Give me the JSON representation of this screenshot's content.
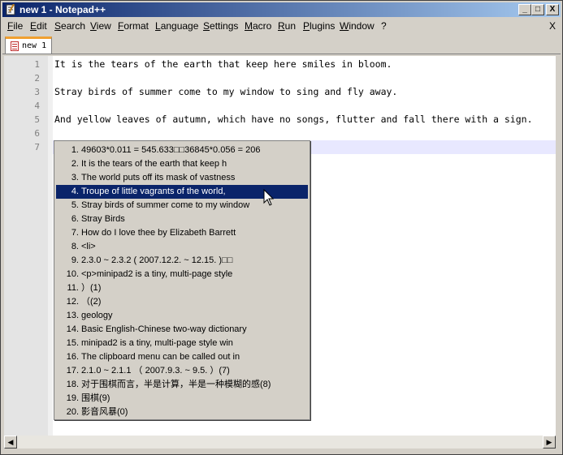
{
  "window": {
    "title": "new 1 - Notepad++",
    "buttons": {
      "minimize": "_",
      "maximize": "□",
      "close": "X"
    }
  },
  "menu": {
    "items": [
      "File",
      "Edit",
      "Search",
      "View",
      "Format",
      "Language",
      "Settings",
      "Macro",
      "Run",
      "Plugins",
      "Window",
      "?"
    ],
    "close": "X"
  },
  "tabs": [
    {
      "label": "new 1"
    }
  ],
  "editor": {
    "line_numbers": [
      "1",
      "2",
      "3",
      "4",
      "5",
      "6",
      "7"
    ],
    "lines": [
      "It is the tears of the earth that keep here smiles in bloom.",
      "",
      "Stray birds of summer come to my window to sing and fly away.",
      "",
      "And yellow leaves of autumn, which have no songs, flutter and fall there with a sign.",
      "",
      ""
    ],
    "current_line": 7
  },
  "clipboard_menu": {
    "selected_index": 3,
    "items": [
      {
        "num": "1.",
        "text": "49603*0.011 = 545.633□□36845*0.056 = 206"
      },
      {
        "num": "2.",
        "text": "It is the tears of the earth that keep h"
      },
      {
        "num": "3.",
        "text": "The world puts off its mask of vastness"
      },
      {
        "num": "4.",
        "text": "Troupe of little vagrants of the world,"
      },
      {
        "num": "5.",
        "text": "Stray birds of summer come to my window"
      },
      {
        "num": "6.",
        "text": "Stray Birds"
      },
      {
        "num": "7.",
        "text": "How do I love thee by Elizabeth Barrett"
      },
      {
        "num": "8.",
        "text": "<li>"
      },
      {
        "num": "9.",
        "text": "2.3.0 ~ 2.3.2 ( 2007.12.2. ~ 12.15. )□□"
      },
      {
        "num": "10.",
        "text": "<p>minipad2 is a tiny, multi-page style"
      },
      {
        "num": "11.",
        "text": "）(1)"
      },
      {
        "num": "12.",
        "text": "（(2)"
      },
      {
        "num": "13.",
        "text": "geology"
      },
      {
        "num": "14.",
        "text": "Basic English-Chinese two-way dictionary"
      },
      {
        "num": "15.",
        "text": "minipad2 is a tiny, multi-page style win"
      },
      {
        "num": "16.",
        "text": "The clipboard menu can be called out in"
      },
      {
        "num": "17.",
        "text": "2.1.0 ~ 2.1.1 （ 2007.9.3. ~ 9.5. ）(7)"
      },
      {
        "num": "18.",
        "text": "对于围棋而言，半是计算，半是一种模糊的感(8)"
      },
      {
        "num": "19.",
        "text": "围棋(9)"
      },
      {
        "num": "20.",
        "text": "影音风暴(0)"
      }
    ]
  },
  "scrollbar": {
    "left_arrow": "◀",
    "right_arrow": "▶"
  }
}
